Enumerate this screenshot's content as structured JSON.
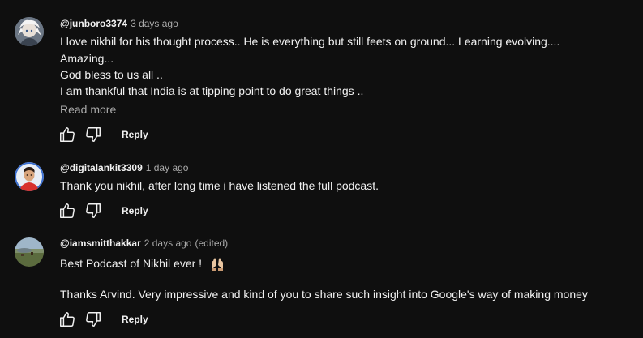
{
  "comments": [
    {
      "author": "@junboro3374",
      "time": "3 days ago",
      "edited": "",
      "lines": [
        "I love nikhil for his thought process.. He is everything but still feets on ground... Learning evolving....",
        "Amazing...",
        "God bless to us all ..",
        "I am thankful that India is at tipping point to do great things .."
      ],
      "read_more": "Read more",
      "reply_label": "Reply",
      "avatar": "anime-character-avatar"
    },
    {
      "author": "@digitalankit3309",
      "time": "1 day ago",
      "edited": "",
      "lines": [
        "Thank you nikhil, after long time i have listened the full podcast."
      ],
      "reply_label": "Reply",
      "avatar": "person-red-shirt-avatar"
    },
    {
      "author": "@iamsmitthakkar",
      "time": "2 days ago",
      "edited": "(edited)",
      "lines": [
        "Best Podcast of Nikhil ever !",
        "",
        "Thanks Arvind. Very impressive and kind of you to share such insight into Google's way of making money"
      ],
      "line_emoji": "raising-hands-emoji",
      "reply_label": "Reply",
      "avatar": "landscape-avatar"
    }
  ],
  "icons": {
    "like": "thumb-up-icon",
    "dislike": "thumb-down-icon"
  },
  "colors": {
    "background": "#0f0f0f",
    "text": "#f1f1f1",
    "secondary_text": "#aaaaaa"
  }
}
